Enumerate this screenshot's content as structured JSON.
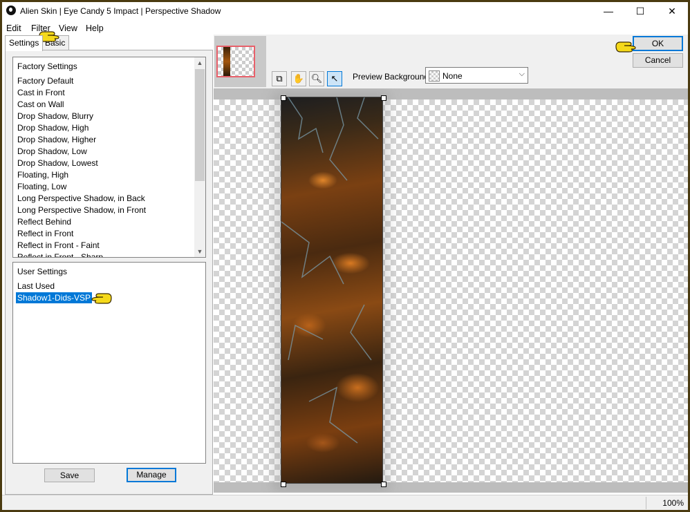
{
  "window": {
    "title": "Alien Skin | Eye Candy 5 Impact | Perspective Shadow",
    "controls": {
      "minimize": "—",
      "maximize": "☐",
      "close": "✕"
    }
  },
  "menu": {
    "items": [
      "Edit",
      "Filter",
      "View",
      "Help"
    ]
  },
  "tabs": {
    "settings": "Settings",
    "basic": "Basic"
  },
  "factory_settings": {
    "header": "Factory Settings",
    "items": [
      "Factory Default",
      "Cast in Front",
      "Cast on Wall",
      "Drop Shadow, Blurry",
      "Drop Shadow, High",
      "Drop Shadow, Higher",
      "Drop Shadow, Low",
      "Drop Shadow, Lowest",
      "Floating, High",
      "Floating, Low",
      "Long Perspective Shadow, in Back",
      "Long Perspective Shadow, in Front",
      "Reflect Behind",
      "Reflect in Front",
      "Reflect in Front - Faint",
      "Reflect in Front - Sharp"
    ]
  },
  "user_settings": {
    "header": "User Settings",
    "items": [
      "Last Used",
      "Shadow1-Dids-VSP"
    ],
    "selected": "Shadow1-Dids-VSP"
  },
  "buttons": {
    "save": "Save",
    "manage": "Manage",
    "ok": "OK",
    "cancel": "Cancel"
  },
  "preview_toolbar": {
    "preview_background_label": "Preview Background:",
    "preview_background_value": "None"
  },
  "status": {
    "zoom": "100%"
  },
  "icons": {
    "pointer": "pointing-hand-icon",
    "tools": [
      "preview-window-icon",
      "hand-pan-icon",
      "zoom-icon",
      "arrow-select-icon"
    ]
  },
  "colors": {
    "selection": "#0078d7",
    "frame": "#4a3a10"
  }
}
